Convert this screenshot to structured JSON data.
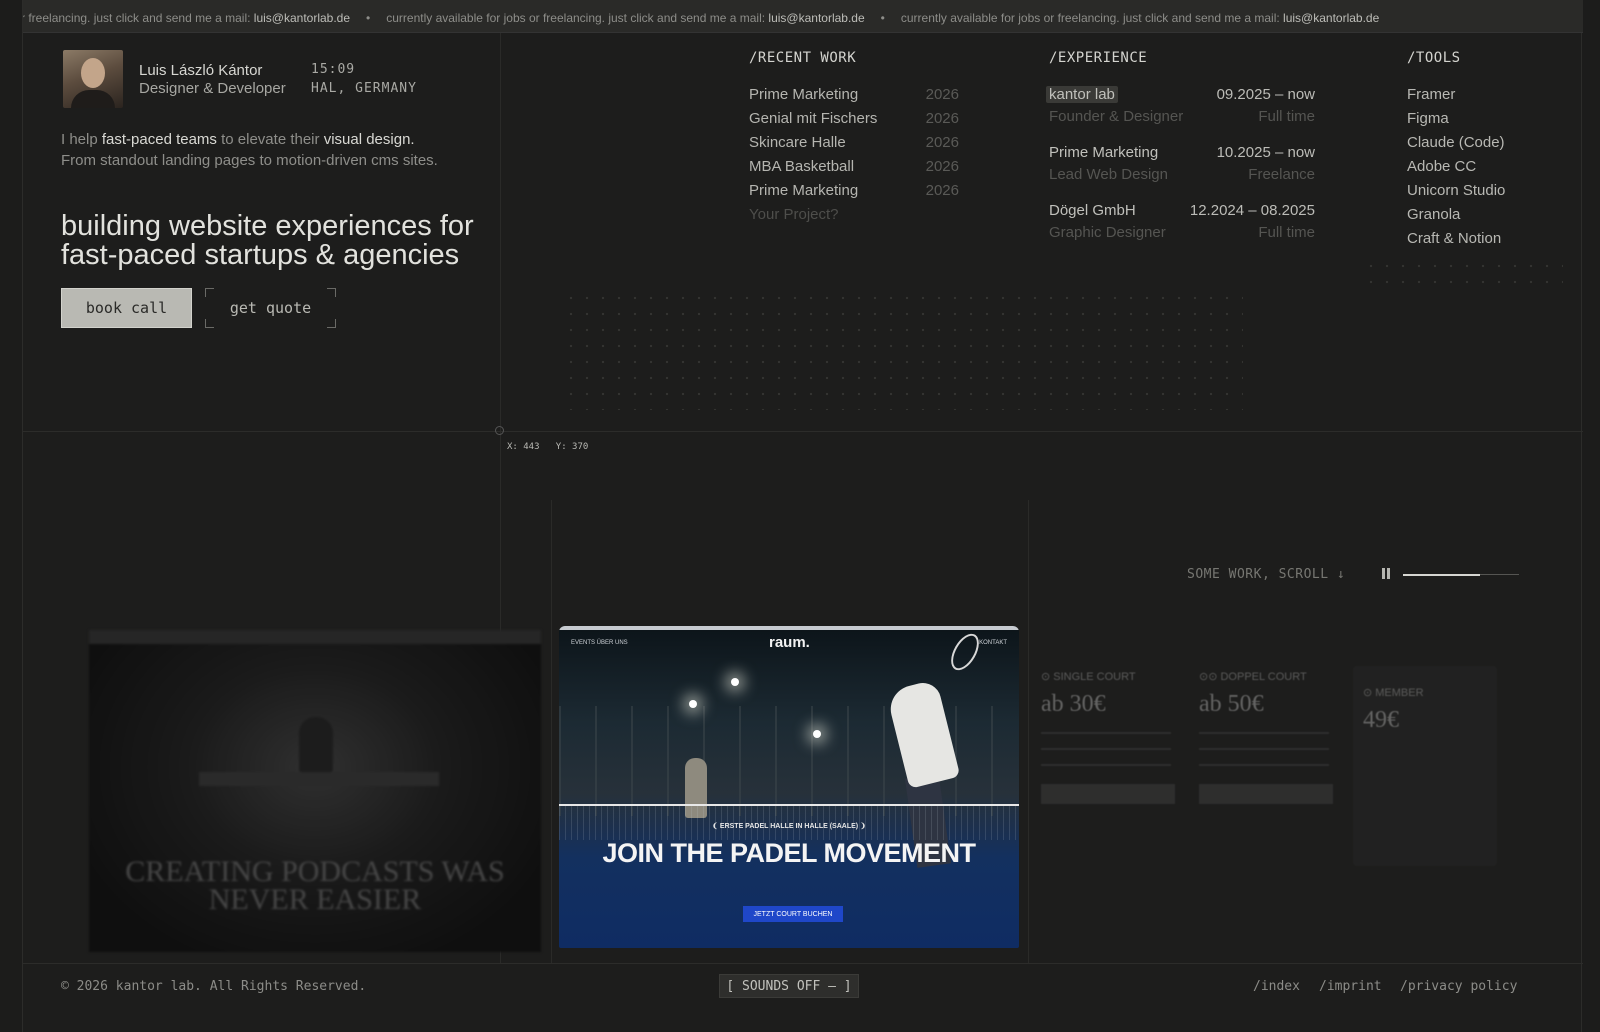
{
  "marquee": {
    "items": [
      {
        "text": "ails or freelancing. just click and send me a mail:",
        "email": "luis@kantorlab.de"
      },
      {
        "text": "currently available for jobs or freelancing. just click and send me a mail:",
        "email": "luis@kantorlab.de"
      },
      {
        "text": "currently available for jobs or freelancing. just click and send me a mail:",
        "email": "luis@kantorlab.de"
      }
    ],
    "separator": "•"
  },
  "profile": {
    "name": "Luis László Kántor",
    "role": "Designer & Developer",
    "time": "15:09",
    "location": "HAL, GERMANY"
  },
  "intro": {
    "p1": "I help",
    "p1_hl": "fast-paced teams",
    "p2": "to elevate their",
    "p2_hl": "visual design.",
    "line2": "From standout landing pages to motion-driven cms sites."
  },
  "headline": "building website experiences for fast-paced startups & agencies",
  "cta": {
    "book": "book call",
    "quote": "get quote"
  },
  "recent_work": {
    "heading": "/RECENT WORK",
    "items": [
      {
        "title": "Prime Marketing",
        "year": "2026"
      },
      {
        "title": "Genial mit Fischers",
        "year": "2026"
      },
      {
        "title": "Skincare Halle",
        "year": "2026"
      },
      {
        "title": "MBA Basketball",
        "year": "2026"
      },
      {
        "title": "Prime Marketing",
        "year": "2026"
      },
      {
        "title": "Your Project?",
        "year": ""
      }
    ]
  },
  "experience": {
    "heading": "/EXPERIENCE",
    "items": [
      {
        "company": "kantor lab",
        "dates": "09.2025 – now",
        "title": "Founder & Designer",
        "type": "Full time"
      },
      {
        "company": "Prime Marketing",
        "dates": "10.2025 – now",
        "title": "Lead Web Design",
        "type": "Freelance"
      },
      {
        "company": "Dögel GmbH",
        "dates": "12.2024 – 08.2025",
        "title": "Graphic Designer",
        "type": "Full time"
      }
    ]
  },
  "tools": {
    "heading": "/TOOLS",
    "items": [
      "Framer",
      "Figma",
      "Claude (Code)",
      "Adobe CC",
      "Unicorn Studio",
      "Granola",
      "Craft & Notion"
    ]
  },
  "cursor": {
    "x_label": "X: 443",
    "y_label": "Y: 370"
  },
  "work_scroll": {
    "label": "SOME WORK, SCROLL ↓",
    "progress": 0.66
  },
  "cards": {
    "podcast": {
      "title": "CREATING PODCASTS WAS NEVER EASIER"
    },
    "padel": {
      "nav": "EVENTS   ÜBER UNS",
      "brand": "raum.",
      "contact": "KONTAKT",
      "kicker": "❨ ERSTE PADEL HALLE IN HALLE (SAALE) ❩",
      "headline": "JOIN THE PADEL MOVEMENT",
      "button": "JETZT COURT BUCHEN"
    },
    "pricing": {
      "plans": [
        {
          "name": "⊙ SINGLE COURT",
          "price": "ab 30€"
        },
        {
          "name": "⊙⊙ DOPPEL COURT",
          "price": "ab 50€"
        }
      ],
      "member": {
        "name": "⊙ MEMBER",
        "price": "49€"
      }
    }
  },
  "footer": {
    "copyright": "© 2026 kantor lab. All Rights Reserved.",
    "sound": "[ SOUNDS OFF — ]",
    "links": [
      "/index",
      "/imprint",
      "/privacy policy"
    ]
  }
}
